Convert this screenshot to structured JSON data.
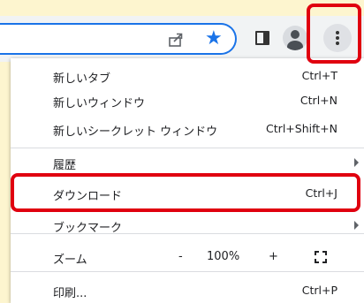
{
  "toolbar": {
    "icons": [
      "share-icon",
      "star-icon",
      "side-panel-icon",
      "profile-avatar",
      "more-menu-icon"
    ]
  },
  "menu": {
    "items": [
      {
        "label": "新しいタブ",
        "shortcut": "Ctrl+T"
      },
      {
        "label": "新しいウィンドウ",
        "shortcut": "Ctrl+N"
      },
      {
        "label": "新しいシークレット ウィンドウ",
        "shortcut": "Ctrl+Shift+N"
      },
      {
        "label": "履歴",
        "shortcut": ""
      },
      {
        "label": "ダウンロード",
        "shortcut": "Ctrl+J"
      },
      {
        "label": "ブックマーク",
        "shortcut": ""
      },
      {
        "label": "ズーム",
        "shortcut": ""
      },
      {
        "label": "印刷...",
        "shortcut": "Ctrl+P"
      }
    ],
    "zoom": {
      "minus": "-",
      "value": "100%",
      "plus": "+"
    }
  },
  "colors": {
    "accent": "#1a73e8",
    "highlight": "#e0000f",
    "background": "#fdf5cf"
  }
}
